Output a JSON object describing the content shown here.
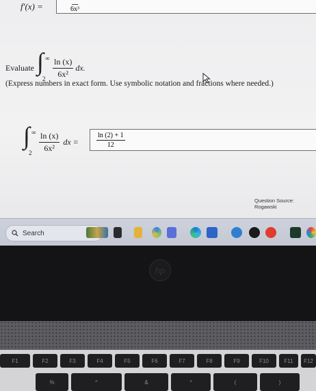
{
  "prev_question": {
    "lhs": "f′(x) =",
    "answer_den": "6x³"
  },
  "question": {
    "prefix": "Evaluate",
    "integral_upper": "∞",
    "integral_lower": "2",
    "integrand_num": "ln (x)",
    "integrand_den": "6x²",
    "dx": "dx.",
    "instruction": "(Express numbers in exact form. Use symbolic notation and fractions where needed.)"
  },
  "answer_row": {
    "integral_upper": "∞",
    "integral_lower": "2",
    "integrand_num": "ln (x)",
    "integrand_den": "6x²",
    "dx_eq": "dx =",
    "answer_num": "ln (2) + 1",
    "answer_den": "12"
  },
  "source": "Question Source: Rogawski",
  "taskbar": {
    "search_placeholder": "Search"
  },
  "laptop": {
    "logo": "hp",
    "key_labels": [
      "F1",
      "F2",
      "F3",
      "F4",
      "F5",
      "F6",
      "F7",
      "F8",
      "F9",
      "F10",
      "F11",
      "F12"
    ],
    "number_row": [
      "%",
      "^",
      "&",
      "*",
      "(",
      ")"
    ]
  }
}
